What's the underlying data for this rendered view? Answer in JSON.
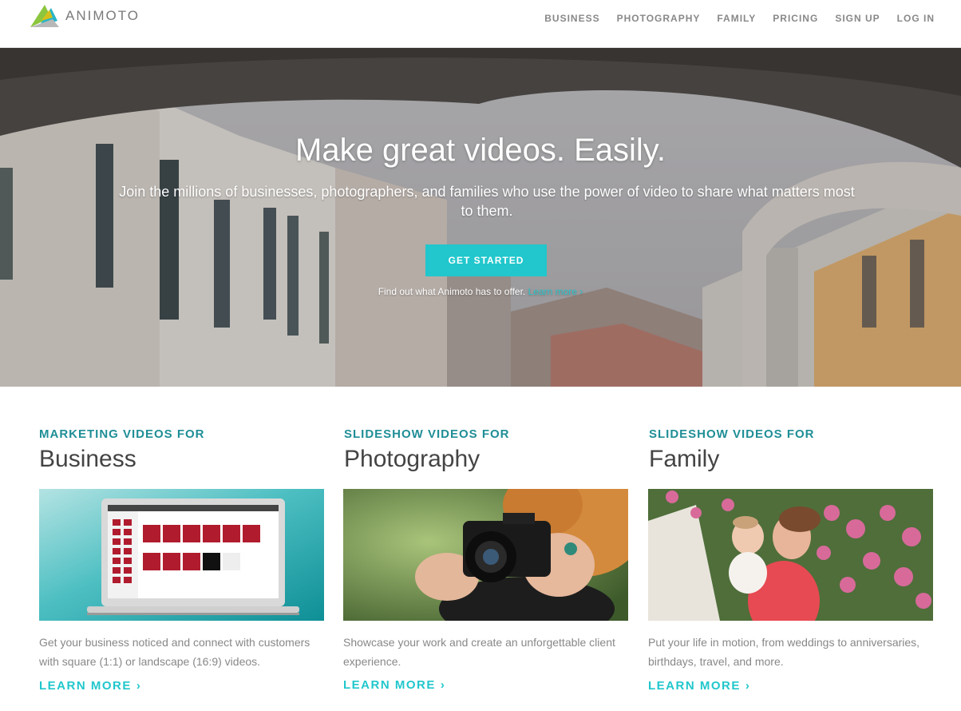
{
  "brand": {
    "name": "ANIMOTO"
  },
  "nav": {
    "items": [
      "BUSINESS",
      "PHOTOGRAPHY",
      "FAMILY",
      "PRICING",
      "SIGN UP",
      "LOG IN"
    ]
  },
  "hero": {
    "title": "Make great videos. Easily.",
    "subtitle": "Join the millions of businesses, photographers, and families who use the power of video to share what matters most to them.",
    "cta_label": "GET STARTED",
    "offer_text": "Find out what Animoto has to offer.",
    "offer_link": "Learn more ›"
  },
  "cards": [
    {
      "kicker": "MARKETING VIDEOS FOR",
      "title": "Business",
      "description": "Get your business noticed and connect with customers with square (1:1) or landscape (16:9) videos.",
      "link": "LEARN MORE"
    },
    {
      "kicker": "SLIDESHOW VIDEOS FOR",
      "title": "Photography",
      "description": "Showcase your work and create an unforgettable client experience.",
      "link": "LEARN MORE"
    },
    {
      "kicker": "SLIDESHOW VIDEOS FOR",
      "title": "Family",
      "description": "Put your life in motion, from weddings to anniversaries, birthdays, travel, and more.",
      "link": "LEARN MORE"
    }
  ],
  "colors": {
    "accent": "#21c7cc",
    "kicker": "#1f8e96",
    "heading": "#444444",
    "body_text": "#888888"
  },
  "icons": {
    "logo": "animoto-logo-icon",
    "chevron": "chevron-right-icon"
  }
}
